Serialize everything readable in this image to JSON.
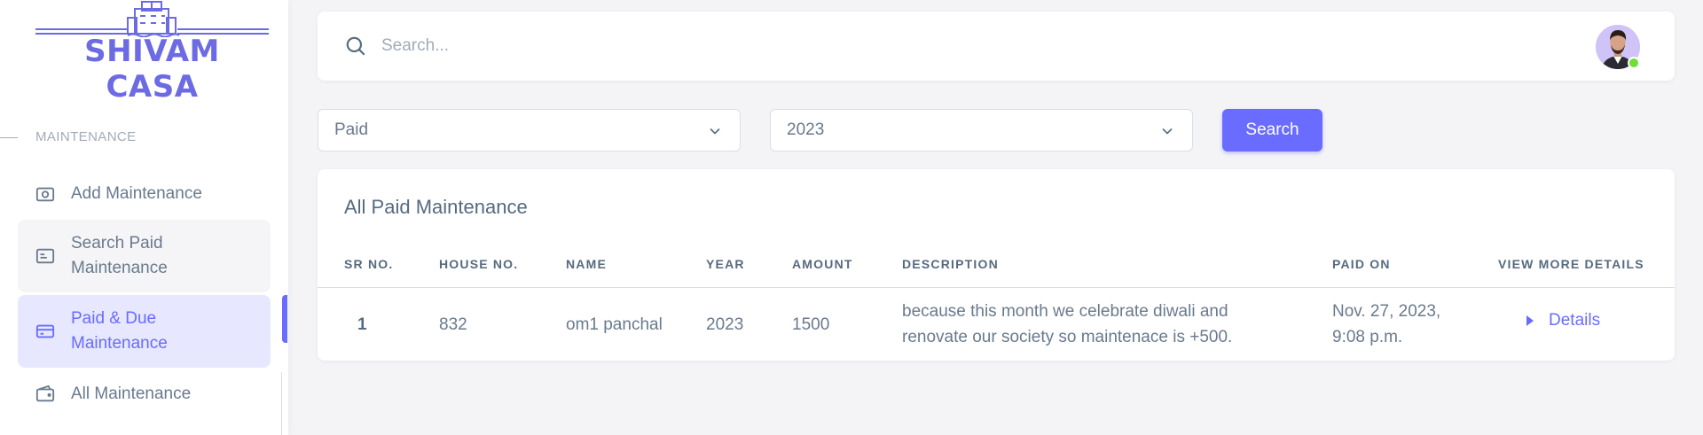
{
  "brand": {
    "name": "SHIVAM CASA",
    "color": "#6c6be4"
  },
  "sidebar": {
    "section_header": "MAINTENANCE",
    "items": [
      {
        "label": "Add Maintenance",
        "icon": "camera-icon",
        "state": "normal"
      },
      {
        "label": "Search Paid Maintenance",
        "icon": "id-card-icon",
        "state": "hover"
      },
      {
        "label": "Paid & Due Maintenance",
        "icon": "credit-card-icon",
        "state": "active"
      },
      {
        "label": "All Maintenance",
        "icon": "wallet-icon",
        "state": "normal"
      }
    ]
  },
  "navbar": {
    "search_placeholder": "Search...",
    "avatar": "user-avatar",
    "status": "online"
  },
  "filters": {
    "status_select": {
      "value": "Paid"
    },
    "year_select": {
      "value": "2023"
    },
    "search_button": "Search"
  },
  "table": {
    "title": "All Paid Maintenance",
    "columns": [
      "SR NO.",
      "HOUSE NO.",
      "NAME",
      "YEAR",
      "AMOUNT",
      "DESCRIPTION",
      "PAID ON",
      "VIEW MORE DETAILS"
    ],
    "rows": [
      {
        "sr_no": "1",
        "house_no": "832",
        "name": "om1 panchal",
        "year": "2023",
        "amount": "1500",
        "description_line1": "because this month we celebrate diwali and",
        "description_line2": "renovate our society so maintenace is +500.",
        "paid_on_line1": "Nov. 27, 2023,",
        "paid_on_line2": "9:08 p.m.",
        "details_label": "Details"
      }
    ]
  },
  "colors": {
    "primary": "#696cff",
    "background": "#f4f4f7",
    "text": "#566a7f",
    "online": "#71dd37"
  }
}
